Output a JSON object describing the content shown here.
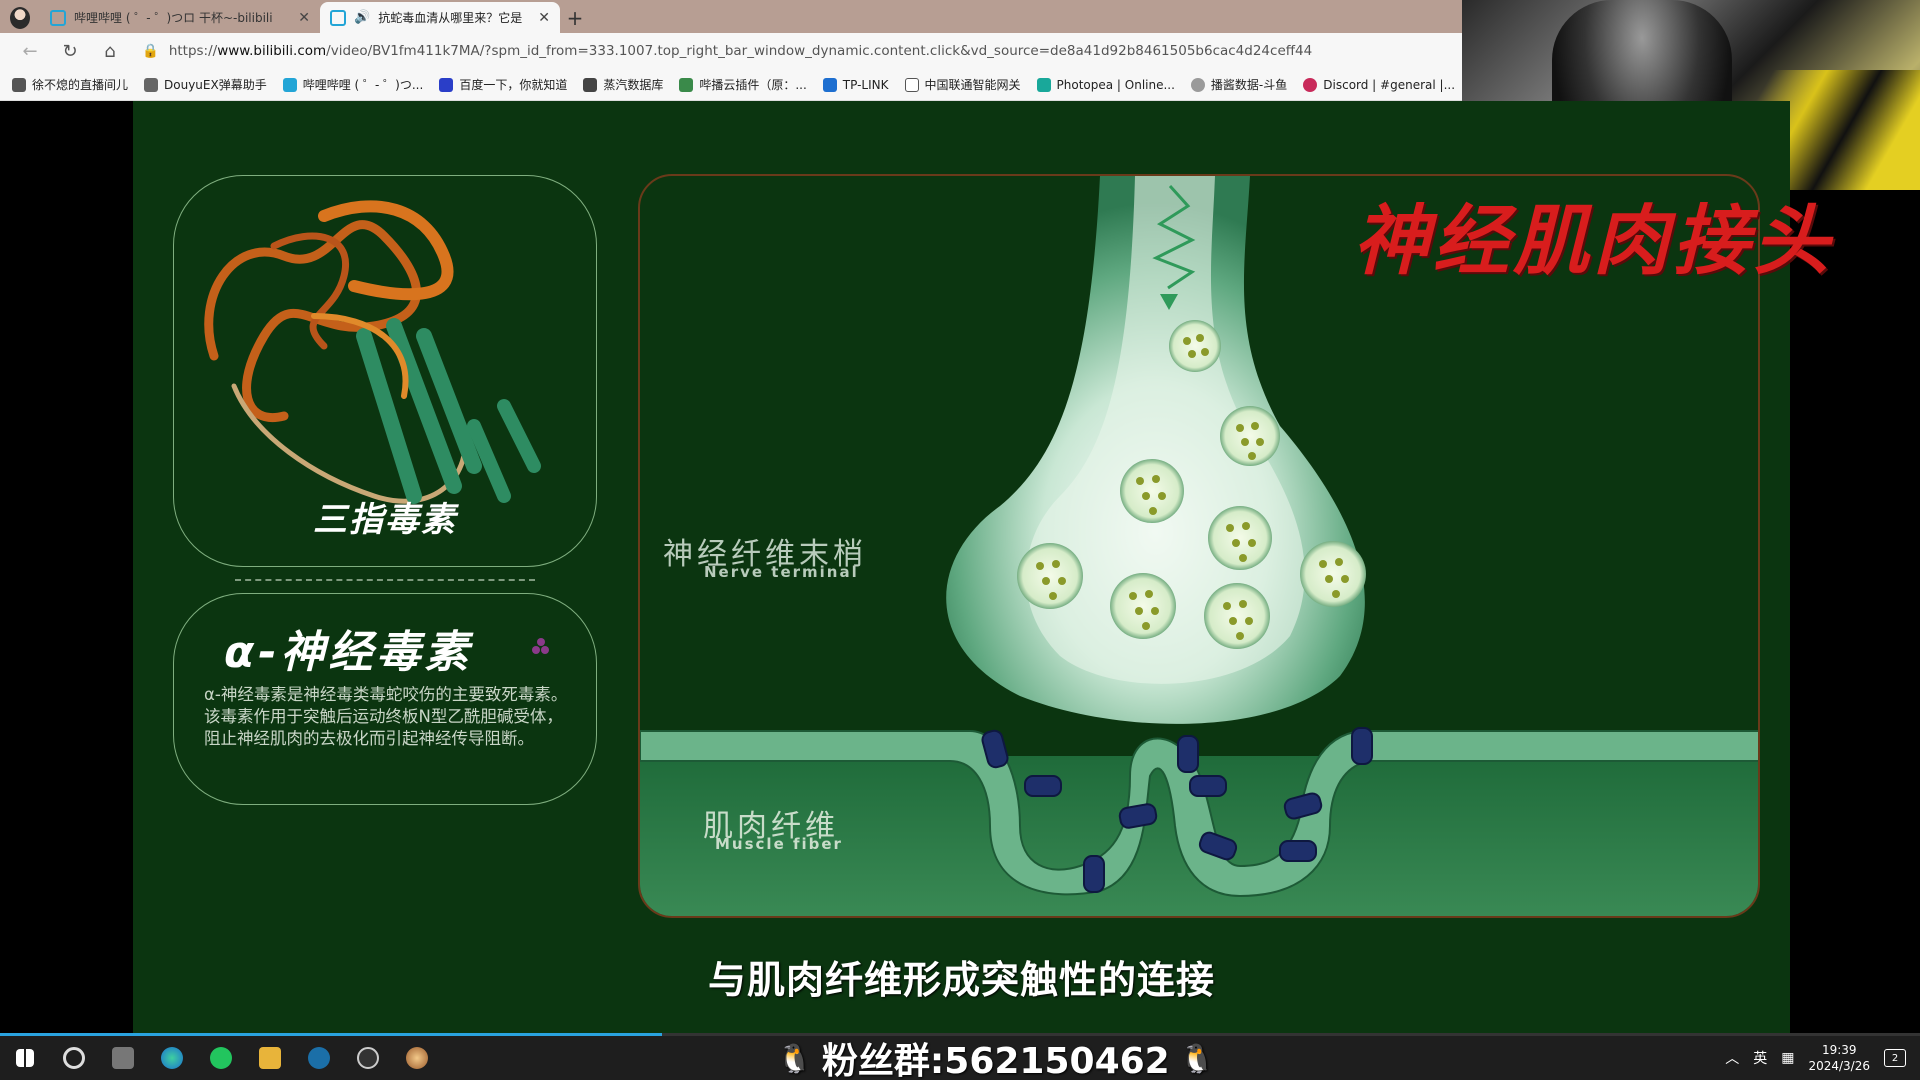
{
  "browser": {
    "tabs": [
      {
        "title": "哔哩哔哩 ( ゜- ゜)つロ 干杯~-bilibili",
        "active": false
      },
      {
        "title": "抗蛇毒血清从哪里来？它是",
        "active": true
      }
    ],
    "url_prefix": "https://",
    "url_host": "www.bilibili.com",
    "url_rest": "/video/BV1fm411k7MA/?spm_id_from=333.1007.top_right_bar_window_dynamic.content.click&vd_source=de8a41d92b8461505b6cac4d24ceff44",
    "bookmarks": [
      "徐不熄的直播间儿",
      "DouyuEX弹幕助手",
      "哔哩哔哩 ( ゜- ゜)つ...",
      "百度一下，你就知道",
      "蒸汽数据库",
      "哔播云插件（原：...",
      "TP-LINK",
      "中国联通智能网关",
      "Photopea | Online...",
      "播酱数据-斗鱼",
      "Discord | #general |..."
    ]
  },
  "video": {
    "protein_caption": "三指毒素",
    "info_title": "α-神经毒素",
    "info_body": "α-神经毒素是神经毒类毒蛇咬伤的主要致死毒素。该毒素作用于突触后运动终板N型乙酰胆碱受体，阻止神经肌肉的去极化而引起神经传导阻断。",
    "diagram_title": "神经肌肉接头",
    "nerve_label_cn": "神经纤维末梢",
    "nerve_label_en": "Nerve terminal",
    "muscle_label_cn": "肌肉纤维",
    "muscle_label_en": "Muscle fiber",
    "subtitle": "与肌肉纤维形成突触性的连接",
    "progress": 0.345
  },
  "overlay": {
    "fan_group": "粉丝群:562150462",
    "penguin_icon": "penguin-icon"
  },
  "taskbar": {
    "ime": "英",
    "time": "19:39",
    "date": "2024/3/26",
    "notifications": "2"
  },
  "colors": {
    "tabbar": "#b79e93",
    "video_bg": "#0b3510",
    "diagram_title": "#d81d1d",
    "progress": "#2aa3e0"
  }
}
